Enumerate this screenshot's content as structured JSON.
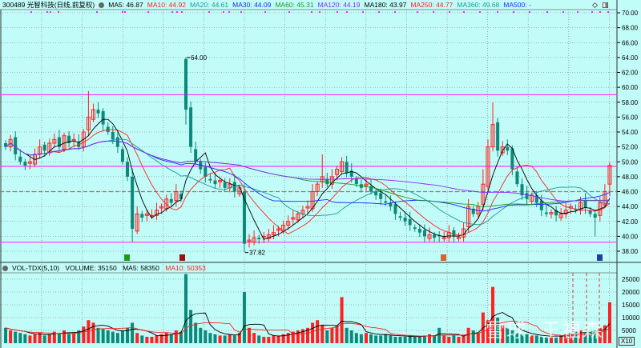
{
  "header": {
    "symbol": "300489 光智科技(日线,前复权)",
    "ma_values": [
      {
        "label": "MA5: 46.87",
        "color": "#000000"
      },
      {
        "label": "MA10: 44.92",
        "color": "#ff2020"
      },
      {
        "label": "MA20: 44.61",
        "color": "#1a9a9a"
      },
      {
        "label": "MA30: 44.09",
        "color": "#1a2aff"
      },
      {
        "label": "MA60: 45.31",
        "color": "#1a9a1a"
      },
      {
        "label": "MA120: 44.19",
        "color": "#8a2aff"
      },
      {
        "label": "MA180: 43.97",
        "color": "#000000"
      },
      {
        "label": "MA250: 44.77",
        "color": "#ff2020"
      },
      {
        "label": "MA360: 49.68",
        "color": "#1a9a9a"
      },
      {
        "label": "MA500: -",
        "color": "#1a2aff"
      }
    ]
  },
  "volume_header": {
    "title": "VOL-TDX(5,10)",
    "volume": "VOLUME: 35150",
    "ma5": "MA5: 58350",
    "ma10": "MA10: 50353"
  },
  "annotations": {
    "high_label": "64.00",
    "low_label": "37.82"
  },
  "volume_scale": "X10",
  "watermark": "雪球: 王福森",
  "colors": {
    "background": "#c2fcf8",
    "up": "#ff2020",
    "down": "#0a8a7a",
    "level_line": "#ff30ff",
    "dashed_line": "#b07070"
  },
  "chart_data": {
    "type": "candlestick",
    "title": "300489 光智科技(日线,前复权)",
    "price_axis": {
      "ylim": [
        37,
        70.6
      ],
      "ticks": [
        38,
        40,
        42,
        44,
        46,
        48,
        50,
        52,
        54,
        56,
        58,
        60,
        62,
        64,
        66,
        68,
        70
      ]
    },
    "volume_axis": {
      "ylim": [
        0,
        28000
      ],
      "ticks": [
        5000,
        10000,
        15000,
        20000,
        25000
      ]
    },
    "horizontal_levels": [
      59.0,
      49.4,
      39.2
    ],
    "dashed_level": 46.0,
    "close": [
      52,
      53,
      51,
      50,
      49.5,
      50,
      51,
      52,
      51.5,
      52.5,
      53,
      52,
      53.5,
      52.5,
      53,
      52,
      54,
      56,
      57,
      56.5,
      55,
      54,
      53,
      52,
      50,
      48,
      41,
      43,
      42.5,
      43,
      42.8,
      43.5,
      44,
      45,
      44.5,
      46,
      45,
      57,
      52,
      50,
      49,
      48,
      47.5,
      47,
      47.5,
      46.5,
      47,
      46,
      46.5,
      39,
      39.5,
      39.8,
      39.6,
      40,
      40.2,
      40.5,
      41,
      41.5,
      42,
      42.5,
      43,
      43.5,
      44,
      46,
      47,
      48,
      47,
      48,
      49,
      50,
      48.5,
      48,
      47,
      46.5,
      47,
      46,
      45.5,
      45,
      44.5,
      44,
      43,
      42.5,
      42,
      41.5,
      41,
      40.5,
      40,
      40.2,
      39.8,
      40,
      39.8,
      40.5,
      40,
      39.9,
      41,
      44,
      43,
      44,
      47,
      52,
      55,
      51.5,
      52,
      51.5,
      49,
      47,
      45.5,
      45,
      45.5,
      44.5,
      43.5,
      43,
      43.2,
      42.8,
      43,
      43.5,
      44,
      43.5,
      44.5,
      43.8,
      43,
      42.5,
      44.5,
      46,
      49.5
    ],
    "wick_overrides": [
      {
        "i": 17,
        "h": 59.5
      },
      {
        "i": 26,
        "o": 48,
        "l": 39.2
      },
      {
        "i": 37,
        "o": 63.8,
        "h": 64,
        "l": 55
      },
      {
        "i": 49,
        "o": 46,
        "l": 37.82
      },
      {
        "i": 65,
        "h": 51
      },
      {
        "i": 69,
        "h": 50.6
      },
      {
        "i": 98,
        "h": 49
      },
      {
        "i": 100,
        "h": 58
      },
      {
        "i": 121,
        "l": 40
      },
      {
        "i": 124,
        "o": 47
      }
    ],
    "volume": [
      6000,
      5000,
      4500,
      4000,
      3500,
      3000,
      3500,
      4000,
      3000,
      3500,
      4500,
      4000,
      5000,
      3500,
      4000,
      5000,
      6500,
      9000,
      8000,
      6000,
      5500,
      5000,
      4500,
      4000,
      5000,
      6000,
      8000,
      4000,
      3000,
      2500,
      2500,
      3000,
      3500,
      4000,
      3500,
      5000,
      4500,
      27000,
      13000,
      8000,
      6000,
      5000,
      4000,
      3500,
      3000,
      3000,
      3500,
      3000,
      4000,
      20000,
      6000,
      4000,
      3000,
      2500,
      2500,
      3000,
      3000,
      3500,
      4000,
      4500,
      5000,
      5500,
      6000,
      8000,
      9000,
      7000,
      5000,
      6000,
      7000,
      18000,
      6000,
      5000,
      4000,
      3500,
      4000,
      3500,
      3000,
      3000,
      3500,
      3000,
      2500,
      2500,
      2500,
      3000,
      2500,
      2500,
      3000,
      3500,
      3000,
      6000,
      3000,
      2500,
      3000,
      2500,
      3000,
      6000,
      5000,
      4000,
      12000,
      9000,
      22000,
      10000,
      7000,
      6000,
      5000,
      4000,
      3500,
      3500,
      3000,
      3000,
      2500,
      2500,
      2500,
      3000,
      3000,
      3500,
      4000,
      4500,
      5000,
      4000,
      4500,
      5000,
      6000,
      7000,
      16000
    ]
  }
}
